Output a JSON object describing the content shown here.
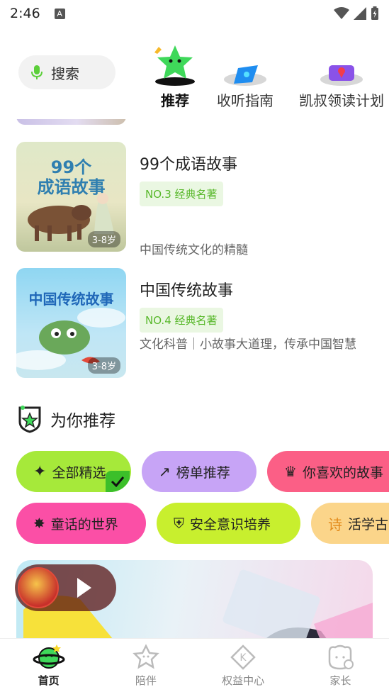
{
  "status_bar": {
    "time": "2:46",
    "a_label": "A"
  },
  "header": {
    "search_label": "搜索",
    "tabs": [
      {
        "label": "推荐",
        "active": true
      },
      {
        "label": "收听指南",
        "active": false
      },
      {
        "label": "凯叔领读计划",
        "active": false
      }
    ]
  },
  "books": [
    {
      "title": "99个成语故事",
      "rank": "NO.3 经典名著",
      "desc": "中国传统文化的精髓",
      "age": "3-8岁",
      "cover_text": "99个\n成语故事"
    },
    {
      "title": "中国传统故事",
      "rank": "NO.4 经典名著",
      "desc": "文化科普｜小故事大道理，传承中国智慧",
      "age": "3-8岁",
      "cover_text": "中国传统故事"
    }
  ],
  "recommend": {
    "title": "为你推荐",
    "chips_row1": [
      {
        "label": "全部精选",
        "color": "#a6e93a",
        "icon": "sparkle-icon",
        "selected": true
      },
      {
        "label": "榜单推荐",
        "color": "#c7a4f6",
        "icon": "trend-icon",
        "selected": false
      },
      {
        "label": "你喜欢的故事",
        "color": "#fb5f86",
        "icon": "crown-icon",
        "selected": false
      }
    ],
    "chips_row2": [
      {
        "label": "童话的世界",
        "color": "#fb4fa6",
        "icon": "star-burst-icon",
        "selected": false
      },
      {
        "label": "安全意识培养",
        "color": "#c8ef2e",
        "icon": "shield-bolt-icon",
        "selected": false
      },
      {
        "label": "活学古",
        "color": "#fbd58a",
        "icon": "poem-icon",
        "selected": false
      }
    ]
  },
  "bottom_nav": [
    {
      "label": "首页",
      "active": true
    },
    {
      "label": "陪伴",
      "active": false
    },
    {
      "label": "权益中心",
      "active": false
    },
    {
      "label": "家长",
      "active": false
    }
  ],
  "colors": {
    "accent_green": "#58b82b",
    "rank_bg": "#eaf7e2"
  }
}
